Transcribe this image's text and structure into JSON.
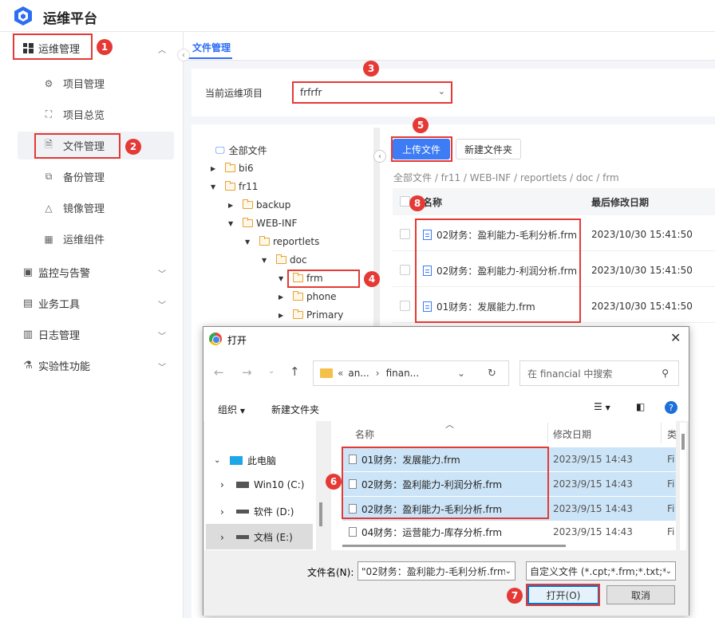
{
  "app": {
    "title": "运维平台"
  },
  "sidebar": {
    "groups": [
      {
        "label": "运维管理",
        "icon": "grid-icon",
        "expanded": true
      },
      {
        "label": "监控与告警",
        "icon": "monitor-icon"
      },
      {
        "label": "业务工具",
        "icon": "toolbox-icon"
      },
      {
        "label": "日志管理",
        "icon": "calendar-icon"
      },
      {
        "label": "实验性功能",
        "icon": "flask-icon"
      }
    ],
    "subitems": [
      {
        "label": "项目管理",
        "icon": "gear-icon"
      },
      {
        "label": "项目总览",
        "icon": "scan-icon"
      },
      {
        "label": "文件管理",
        "icon": "file-gear-icon",
        "selected": true
      },
      {
        "label": "备份管理",
        "icon": "copy-icon"
      },
      {
        "label": "镜像管理",
        "icon": "mirror-icon"
      },
      {
        "label": "运维组件",
        "icon": "components-icon"
      }
    ]
  },
  "main": {
    "tab": "文件管理",
    "project_label": "当前运维项目",
    "project_value": "frfrfr",
    "upload_button": "上传文件",
    "new_folder_button": "新建文件夹",
    "breadcrumb": "全部文件 / fr11 / WEB-INF / reportlets / doc / frm",
    "table": {
      "col_name": "名称",
      "col_date": "最后修改日期",
      "rows": [
        {
          "name": "02财务：盈利能力-毛利分析.frm",
          "date": "2023/10/30 15:41:50"
        },
        {
          "name": "02财务：盈利能力-利润分析.frm",
          "date": "2023/10/30 15:41:50"
        },
        {
          "name": "01财务：发展能力.frm",
          "date": "2023/10/30 15:41:50"
        }
      ]
    },
    "tree": {
      "root": "全部文件",
      "items": [
        "bi6",
        "fr11",
        "backup",
        "WEB-INF",
        "reportlets",
        "doc",
        "frm",
        "phone",
        "Primary"
      ]
    }
  },
  "dialog": {
    "title": "打开",
    "address": {
      "part1": "an...",
      "part2": "finan..."
    },
    "search_placeholder": "在 financial 中搜索",
    "organize": "组织",
    "new_folder": "新建文件夹",
    "left": [
      {
        "label": "此电脑"
      },
      {
        "label": "Win10 (C:)"
      },
      {
        "label": "软件 (D:)"
      },
      {
        "label": "文档 (E:)"
      }
    ],
    "col_name": "名称",
    "col_date": "修改日期",
    "col_type": "类",
    "files": [
      {
        "name": "01财务：发展能力.frm",
        "date": "2023/9/15 14:43",
        "type": "Fi"
      },
      {
        "name": "02财务：盈利能力-利润分析.frm",
        "date": "2023/9/15 14:43",
        "type": "Fi"
      },
      {
        "name": "02财务：盈利能力-毛利分析.frm",
        "date": "2023/9/15 14:43",
        "type": "Fi"
      },
      {
        "name": "04财务：运营能力-库存分析.frm",
        "date": "2023/9/15 14:43",
        "type": "Fi"
      }
    ],
    "filename_label": "文件名(N):",
    "filename_value": "\"02财务：盈利能力-毛利分析.frm",
    "filetype_value": "自定义文件 (*.cpt;*.frm;*.txt;*.",
    "open_button": "打开(O)",
    "cancel_button": "取消"
  },
  "annotations": [
    "1",
    "2",
    "3",
    "4",
    "5",
    "6",
    "7",
    "8"
  ]
}
